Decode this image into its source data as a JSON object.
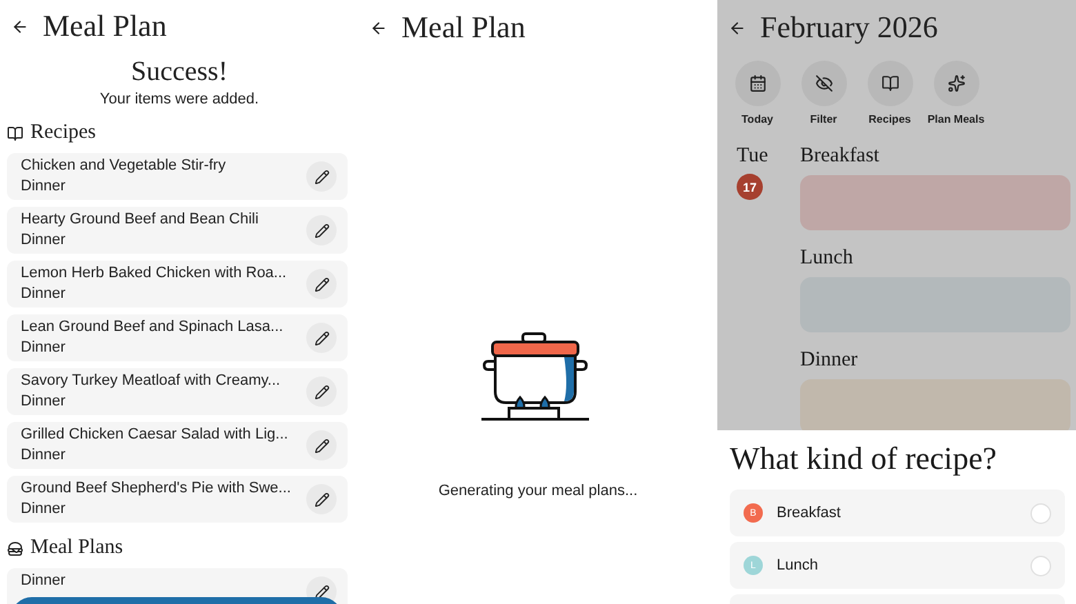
{
  "success_screen": {
    "title": "Meal Plan",
    "heading": "Success!",
    "message": "Your items were added.",
    "sections": [
      {
        "kind": "recipes",
        "title": "Recipes",
        "items": [
          {
            "name": "Chicken and Vegetable Stir-fry",
            "meal": "Dinner"
          },
          {
            "name": "Hearty Ground Beef and Bean Chili",
            "meal": "Dinner"
          },
          {
            "name": "Lemon Herb Baked Chicken with Roa...",
            "meal": "Dinner"
          },
          {
            "name": "Lean Ground Beef and Spinach Lasa...",
            "meal": "Dinner"
          },
          {
            "name": "Savory Turkey Meatloaf with Creamy...",
            "meal": "Dinner"
          },
          {
            "name": "Grilled Chicken Caesar Salad with Lig...",
            "meal": "Dinner"
          },
          {
            "name": "Ground Beef Shepherd's Pie with Swe...",
            "meal": "Dinner"
          }
        ]
      },
      {
        "kind": "meal_plans",
        "title": "Meal Plans",
        "items": [
          {
            "meal": "Dinner"
          }
        ]
      }
    ]
  },
  "loading_screen": {
    "title": "Meal Plan",
    "message": "Generating your meal plans..."
  },
  "calendar_screen": {
    "title": "February 2026",
    "actions": [
      {
        "kind": "today",
        "label": "Today"
      },
      {
        "kind": "filter",
        "label": "Filter"
      },
      {
        "kind": "recipes",
        "label": "Recipes"
      },
      {
        "kind": "plan",
        "label": "Plan Meals"
      }
    ],
    "day": {
      "weekday": "Tue",
      "date": "17"
    },
    "meals": [
      {
        "label": "Breakfast",
        "color": "#bfa7a6"
      },
      {
        "label": "Lunch",
        "color": "#b3b9bb"
      },
      {
        "label": "Dinner",
        "color": "#c1b8ac"
      }
    ],
    "sheet": {
      "title": "What kind of recipe?",
      "options": [
        {
          "initial": "B",
          "label": "Breakfast",
          "color": "#f26b4f",
          "selected": false
        },
        {
          "initial": "L",
          "label": "Lunch",
          "color": "#9ed6d8",
          "selected": false
        }
      ]
    }
  }
}
